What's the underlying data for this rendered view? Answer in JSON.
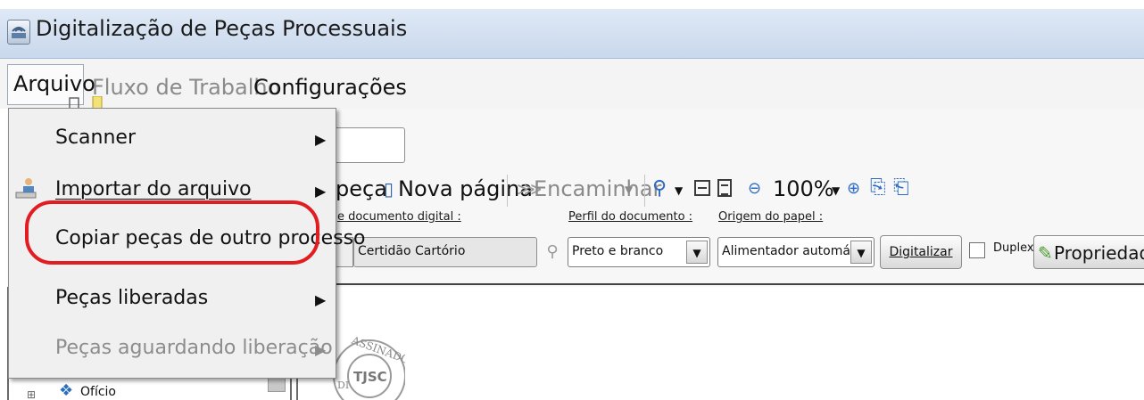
{
  "window": {
    "title": "Digitalização de Peças Processuais",
    "icon": "scanner-app-icon"
  },
  "menubar": {
    "items": [
      "Arquivo",
      "Fluxo de Trabalho",
      "Configurações"
    ]
  },
  "dropdown": {
    "items": [
      {
        "label": "Scanner",
        "submenu": true,
        "enabled": true
      },
      {
        "label": "Importar do arquivo",
        "submenu": true,
        "enabled": true,
        "icon": "import-icon"
      },
      {
        "label": "Copiar peças de outro processo",
        "submenu": false,
        "enabled": true,
        "highlighted": true
      },
      {
        "label": "Peças liberadas",
        "submenu": true,
        "enabled": true
      },
      {
        "label": "Peças aguardando liberação",
        "submenu": true,
        "enabled": false
      }
    ],
    "submenu_arrow": "▶",
    "highlight_color": "#e21d22"
  },
  "toolbar": {
    "peca_label": "peça",
    "nova_pagina_label": "Nova página",
    "encaminhar_label": "Encaminhar",
    "zoom_value": "100%"
  },
  "fields": {
    "tipo_label": "e documento digital :",
    "tipo_value": "Certidão Cartório",
    "perfil_label": "Perfil do documento :",
    "perfil_value": "Preto e branco",
    "origem_label": "Origem do papel :",
    "origem_value": "Alimentador automático",
    "digitalizar_label": "Digitalizar",
    "duplex_label": "Duplex",
    "duplex_checked": false,
    "propriedades_label": "Propriedade"
  },
  "tree": {
    "partial_item": "Ofício"
  },
  "seal": {
    "text_top": "ASSINADO",
    "text_center": "TJSC",
    "text_left": "DI"
  }
}
